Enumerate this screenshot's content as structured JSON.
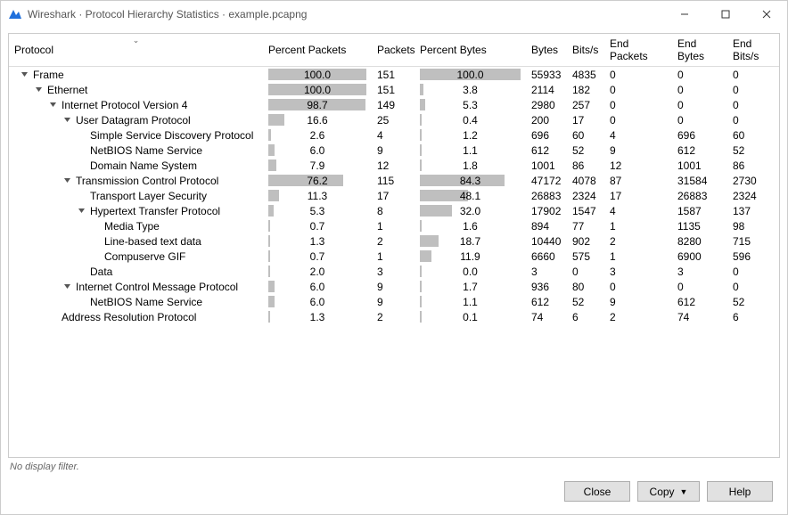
{
  "window": {
    "title": "Wireshark · Protocol Hierarchy Statistics · example.pcapng"
  },
  "columns": {
    "protocol": "Protocol",
    "percent_packets": "Percent Packets",
    "packets": "Packets",
    "percent_bytes": "Percent Bytes",
    "bytes": "Bytes",
    "bits_s": "Bits/s",
    "end_packets": "End Packets",
    "end_bytes": "End Bytes",
    "end_bits_s": "End Bits/s"
  },
  "rows": [
    {
      "indent": 0,
      "exp": "down",
      "name": "Frame",
      "pp": 100.0,
      "pkt": 151,
      "pb": 100.0,
      "bytes": 55933,
      "bits": 4835,
      "ep": 0,
      "eb": 0,
      "ebits": 0
    },
    {
      "indent": 1,
      "exp": "down",
      "name": "Ethernet",
      "pp": 100.0,
      "pkt": 151,
      "pb": 3.8,
      "bytes": 2114,
      "bits": 182,
      "ep": 0,
      "eb": 0,
      "ebits": 0
    },
    {
      "indent": 2,
      "exp": "down",
      "name": "Internet Protocol Version 4",
      "pp": 98.7,
      "pkt": 149,
      "pb": 5.3,
      "bytes": 2980,
      "bits": 257,
      "ep": 0,
      "eb": 0,
      "ebits": 0
    },
    {
      "indent": 3,
      "exp": "down",
      "name": "User Datagram Protocol",
      "pp": 16.6,
      "pkt": 25,
      "pb": 0.4,
      "bytes": 200,
      "bits": 17,
      "ep": 0,
      "eb": 0,
      "ebits": 0
    },
    {
      "indent": 4,
      "exp": "",
      "name": "Simple Service Discovery Protocol",
      "pp": 2.6,
      "pkt": 4,
      "pb": 1.2,
      "bytes": 696,
      "bits": 60,
      "ep": 4,
      "eb": 696,
      "ebits": 60
    },
    {
      "indent": 4,
      "exp": "",
      "name": "NetBIOS Name Service",
      "pp": 6.0,
      "pkt": 9,
      "pb": 1.1,
      "bytes": 612,
      "bits": 52,
      "ep": 9,
      "eb": 612,
      "ebits": 52
    },
    {
      "indent": 4,
      "exp": "",
      "name": "Domain Name System",
      "pp": 7.9,
      "pkt": 12,
      "pb": 1.8,
      "bytes": 1001,
      "bits": 86,
      "ep": 12,
      "eb": 1001,
      "ebits": 86
    },
    {
      "indent": 3,
      "exp": "down",
      "name": "Transmission Control Protocol",
      "pp": 76.2,
      "pkt": 115,
      "pb": 84.3,
      "bytes": 47172,
      "bits": 4078,
      "ep": 87,
      "eb": 31584,
      "ebits": 2730
    },
    {
      "indent": 4,
      "exp": "",
      "name": "Transport Layer Security",
      "pp": 11.3,
      "pkt": 17,
      "pb": 48.1,
      "bytes": 26883,
      "bits": 2324,
      "ep": 17,
      "eb": 26883,
      "ebits": 2324
    },
    {
      "indent": 4,
      "exp": "down",
      "name": "Hypertext Transfer Protocol",
      "pp": 5.3,
      "pkt": 8,
      "pb": 32.0,
      "bytes": 17902,
      "bits": 1547,
      "ep": 4,
      "eb": 1587,
      "ebits": 137
    },
    {
      "indent": 5,
      "exp": "",
      "name": "Media Type",
      "pp": 0.7,
      "pkt": 1,
      "pb": 1.6,
      "bytes": 894,
      "bits": 77,
      "ep": 1,
      "eb": 1135,
      "ebits": 98
    },
    {
      "indent": 5,
      "exp": "",
      "name": "Line-based text data",
      "pp": 1.3,
      "pkt": 2,
      "pb": 18.7,
      "bytes": 10440,
      "bits": 902,
      "ep": 2,
      "eb": 8280,
      "ebits": 715
    },
    {
      "indent": 5,
      "exp": "",
      "name": "Compuserve GIF",
      "pp": 0.7,
      "pkt": 1,
      "pb": 11.9,
      "bytes": 6660,
      "bits": 575,
      "ep": 1,
      "eb": 6900,
      "ebits": 596
    },
    {
      "indent": 4,
      "exp": "",
      "name": "Data",
      "pp": 2.0,
      "pkt": 3,
      "pb": 0.0,
      "bytes": 3,
      "bits": 0,
      "ep": 3,
      "eb": 3,
      "ebits": 0
    },
    {
      "indent": 3,
      "exp": "down",
      "name": "Internet Control Message Protocol",
      "pp": 6.0,
      "pkt": 9,
      "pb": 1.7,
      "bytes": 936,
      "bits": 80,
      "ep": 0,
      "eb": 0,
      "ebits": 0
    },
    {
      "indent": 4,
      "exp": "",
      "name": "NetBIOS Name Service",
      "pp": 6.0,
      "pkt": 9,
      "pb": 1.1,
      "bytes": 612,
      "bits": 52,
      "ep": 9,
      "eb": 612,
      "ebits": 52
    },
    {
      "indent": 2,
      "exp": "",
      "name": "Address Resolution Protocol",
      "pp": 1.3,
      "pkt": 2,
      "pb": 0.1,
      "bytes": 74,
      "bits": 6,
      "ep": 2,
      "eb": 74,
      "ebits": 6
    }
  ],
  "status": {
    "filter_text": "No display filter."
  },
  "buttons": {
    "close": "Close",
    "copy": "Copy",
    "help": "Help"
  }
}
